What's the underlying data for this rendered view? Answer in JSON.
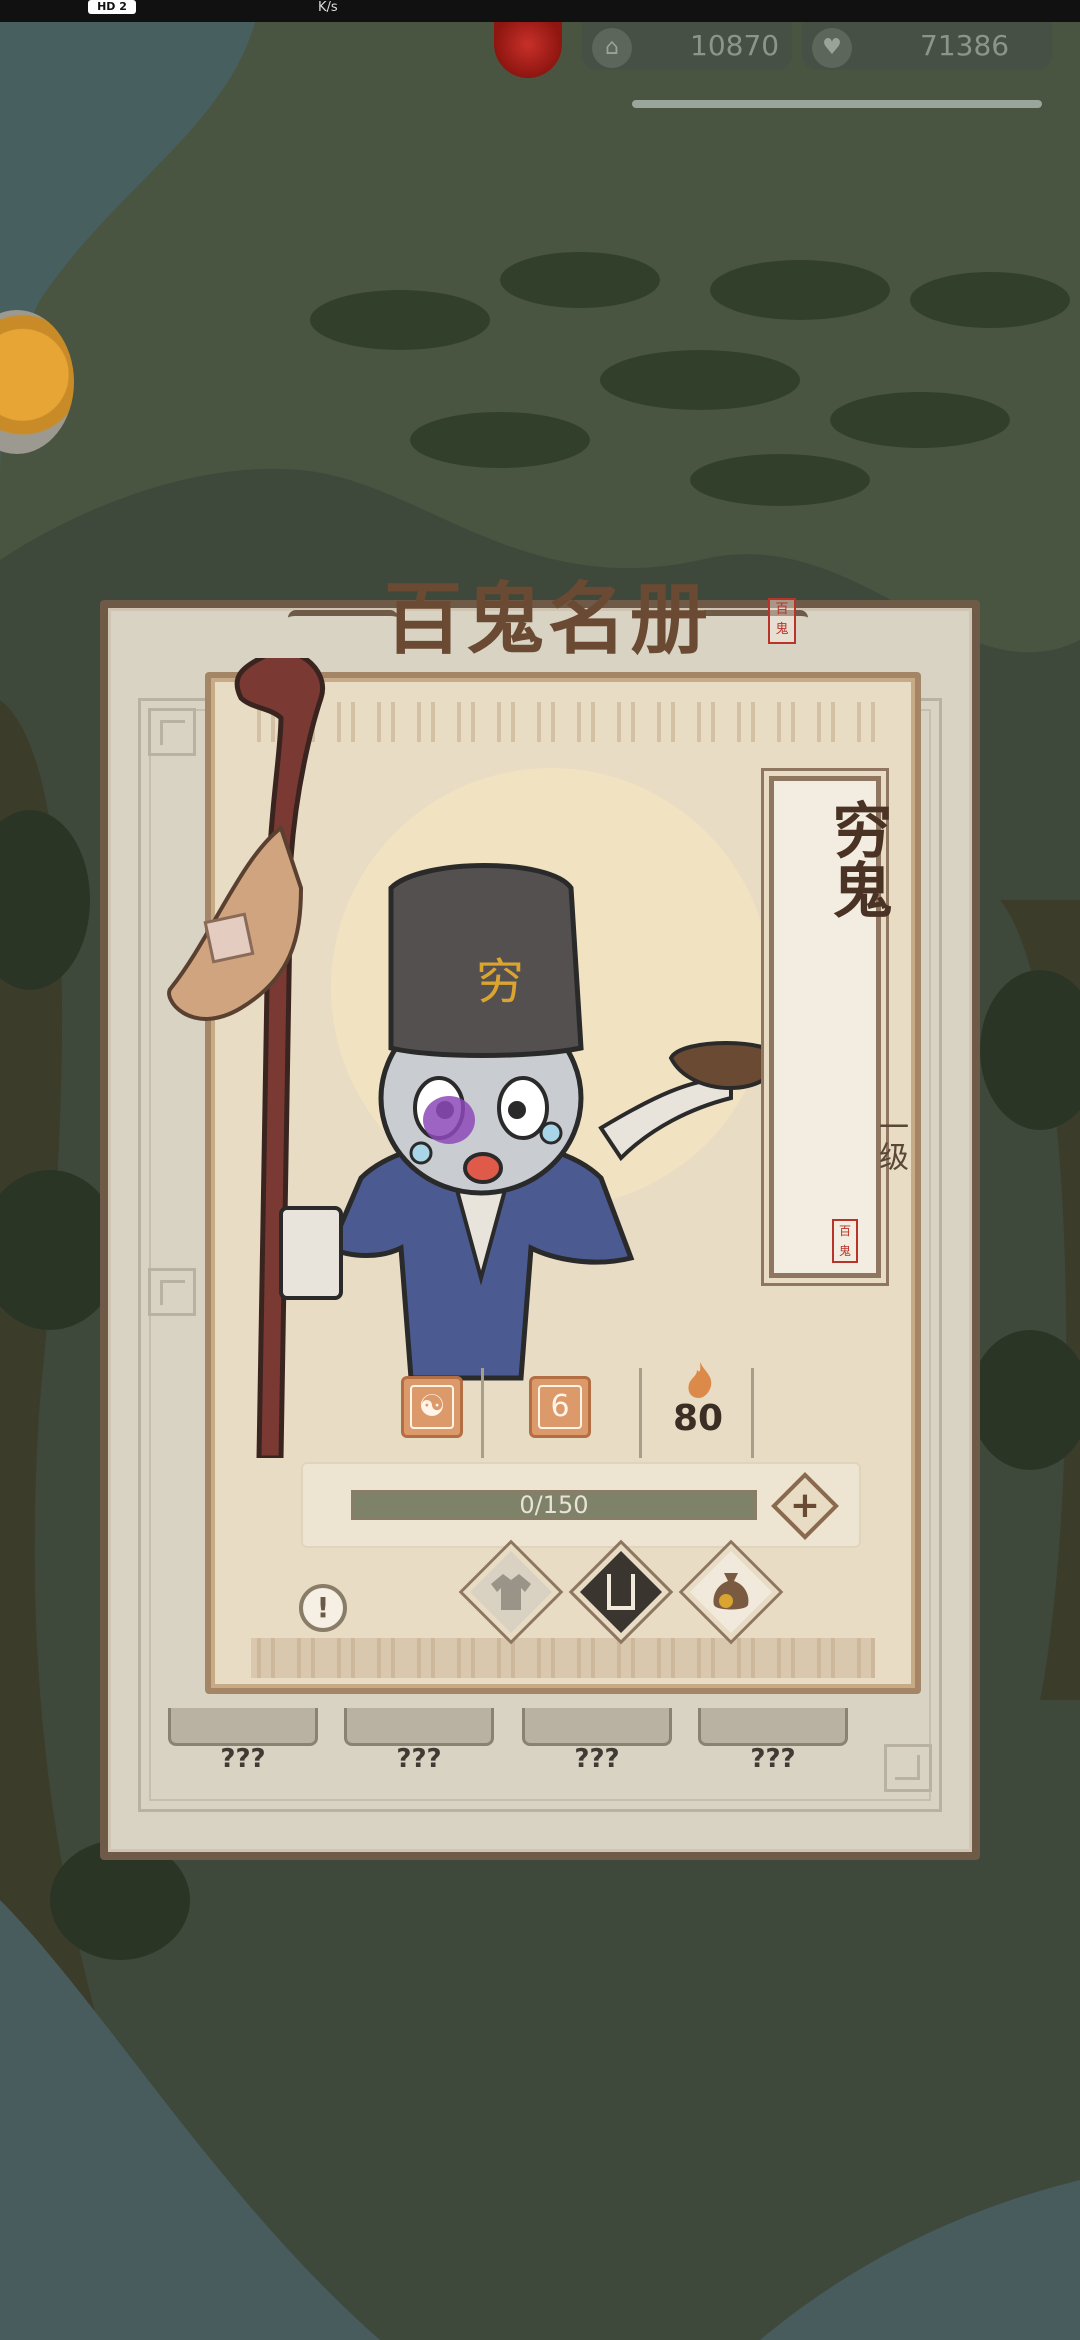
{
  "status_bar": {
    "hd_badge": "HD 2",
    "net_speed": "K/s"
  },
  "hud": {
    "gold": {
      "icon": "temple-coin-icon",
      "value": "10870"
    },
    "life": {
      "icon": "heart-icon",
      "value": "71386"
    }
  },
  "roster": {
    "title": "百鬼名册",
    "title_seal": "百鬼",
    "locked_slots": [
      "???",
      "???",
      "???",
      "???"
    ]
  },
  "ghost": {
    "name": "穷鬼",
    "level": "一级",
    "name_seal": "百鬼",
    "hat_glyph": "穷",
    "element_icon": "yin-yang-icon",
    "rank": "6",
    "fire_value": "80",
    "exp_text": "0/150",
    "exp_progress": 0.0,
    "actions": [
      "robe-icon",
      "book-icon",
      "money-bag-icon"
    ]
  },
  "colors": {
    "panel_border": "#6f5a48",
    "card_paper": "#e8dcc4",
    "accent_orange": "#dc9a6a",
    "seal_red": "#b8342a",
    "exp_bar": "#7d8269"
  }
}
